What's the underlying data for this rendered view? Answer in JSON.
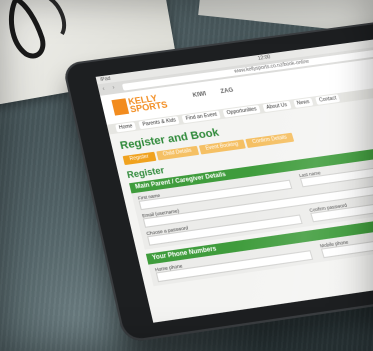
{
  "browser": {
    "status_left": "iPad",
    "status_time": "12:00",
    "url": "www.kellysports.co.nz/book-online"
  },
  "site": {
    "logo_line1": "KELLY",
    "logo_line2": "SPORTS",
    "sponsor1": "KIWI",
    "sponsor2": "ZAG",
    "menu": [
      "Home",
      "Parents & Kids",
      "Find an Event",
      "Opportunities",
      "About Us",
      "News",
      "Contact"
    ]
  },
  "page": {
    "title": "Register and Book",
    "steps": [
      "Register",
      "Child Details",
      "Event Booking",
      "Confirm Details"
    ],
    "section_title": "Register",
    "main_section": "Main Parent / Caregiver Details",
    "fields": [
      "First name",
      "Last name",
      "Email (username)",
      "Choose a password",
      "Confirm password"
    ],
    "phone_section": "Your Phone Numbers",
    "phone_fields": [
      "Home phone",
      "Mobile phone"
    ]
  },
  "colors": {
    "brand_orange": "#f28c1f",
    "brand_green": "#3f9c3c",
    "step_active": "#f0a21f"
  }
}
